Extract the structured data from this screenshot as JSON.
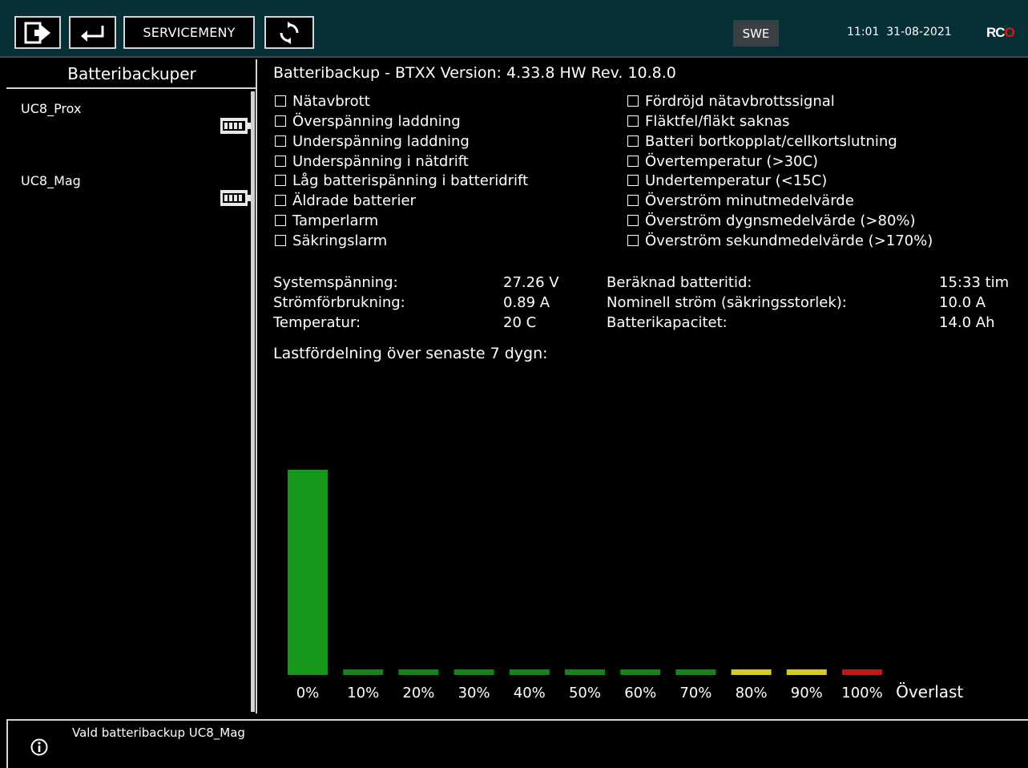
{
  "topbar": {
    "service_label": "SERVICEMENY",
    "language": "SWE",
    "time": "11:01",
    "date": "31-08-2021",
    "logo_r": "R",
    "logo_c": "C",
    "logo_o": "O",
    "icons": [
      "exit-icon",
      "return-icon",
      "refresh-icon"
    ]
  },
  "sidebar": {
    "title": "Batteribackuper",
    "items": [
      {
        "label": "UC8_Prox",
        "icon": "battery-full-icon"
      },
      {
        "label": "UC8_Mag",
        "icon": "battery-full-icon"
      }
    ]
  },
  "main": {
    "title": "Batteribackup - BTXX Version: 4.33.8 HW Rev. 10.8.0",
    "alarms_left": [
      {
        "label": "Nätavbrott",
        "checked": false
      },
      {
        "label": "Överspänning laddning",
        "checked": false
      },
      {
        "label": "Underspänning laddning",
        "checked": false
      },
      {
        "label": "Underspänning i nätdrift",
        "checked": false
      },
      {
        "label": "Låg batterispänning i batteridrift",
        "checked": false
      },
      {
        "label": "Äldrade batterier",
        "checked": false
      },
      {
        "label": "Tamperlarm",
        "checked": false
      },
      {
        "label": "Säkringslarm",
        "checked": false
      }
    ],
    "alarms_right": [
      {
        "label": "Fördröjd nätavbrottssignal",
        "checked": false
      },
      {
        "label": "Fläktfel/fläkt saknas",
        "checked": false
      },
      {
        "label": "Batteri bortkopplat/cellkortslutning",
        "checked": false
      },
      {
        "label": "Övertemperatur (>30C)",
        "checked": false
      },
      {
        "label": "Undertemperatur (<15C)",
        "checked": false
      },
      {
        "label": "Överström minutmedelvärde",
        "checked": false
      },
      {
        "label": "Överström dygnsmedelvärde (>80%)",
        "checked": false
      },
      {
        "label": "Överström sekundmedelvärde (>170%)",
        "checked": false
      }
    ],
    "stats_left": [
      {
        "label": "Systemspänning:",
        "value": "27.26 V"
      },
      {
        "label": "Strömförbrukning:",
        "value": "0.89 A"
      },
      {
        "label": "Temperatur:",
        "value": "20 C"
      }
    ],
    "stats_right": [
      {
        "label": "Beräknad batteritid:",
        "value": "15:33 tim"
      },
      {
        "label": "Nominell ström (säkringsstorlek):",
        "value": "10.0 A"
      },
      {
        "label": "Batterikapacitet:",
        "value": "14.0 Ah"
      }
    ],
    "chart_title": "Lastfördelning över senaste 7 dygn:"
  },
  "chart_data": {
    "type": "bar",
    "categories": [
      "0%",
      "10%",
      "20%",
      "30%",
      "40%",
      "50%",
      "60%",
      "70%",
      "80%",
      "90%",
      "100%",
      "Överlast"
    ],
    "values": [
      100,
      2.5,
      2.5,
      2.5,
      2.5,
      2.5,
      2.5,
      2.5,
      2.5,
      2.5,
      2.5,
      0
    ],
    "bar_colors": [
      "#16961a",
      "#0e8a14",
      "#0e8a14",
      "#0e8a14",
      "#0e8a14",
      "#0e8a14",
      "#0e8a14",
      "#0e8a14",
      "#d8cc1a",
      "#d8cc1a",
      "#c81414",
      "#c81414"
    ],
    "ylim": [
      0,
      100
    ],
    "grid": false,
    "title": "",
    "xlabel": "",
    "ylabel": ""
  },
  "status": {
    "message": "Vald batteribackup UC8_Mag",
    "icon": "info-icon"
  }
}
